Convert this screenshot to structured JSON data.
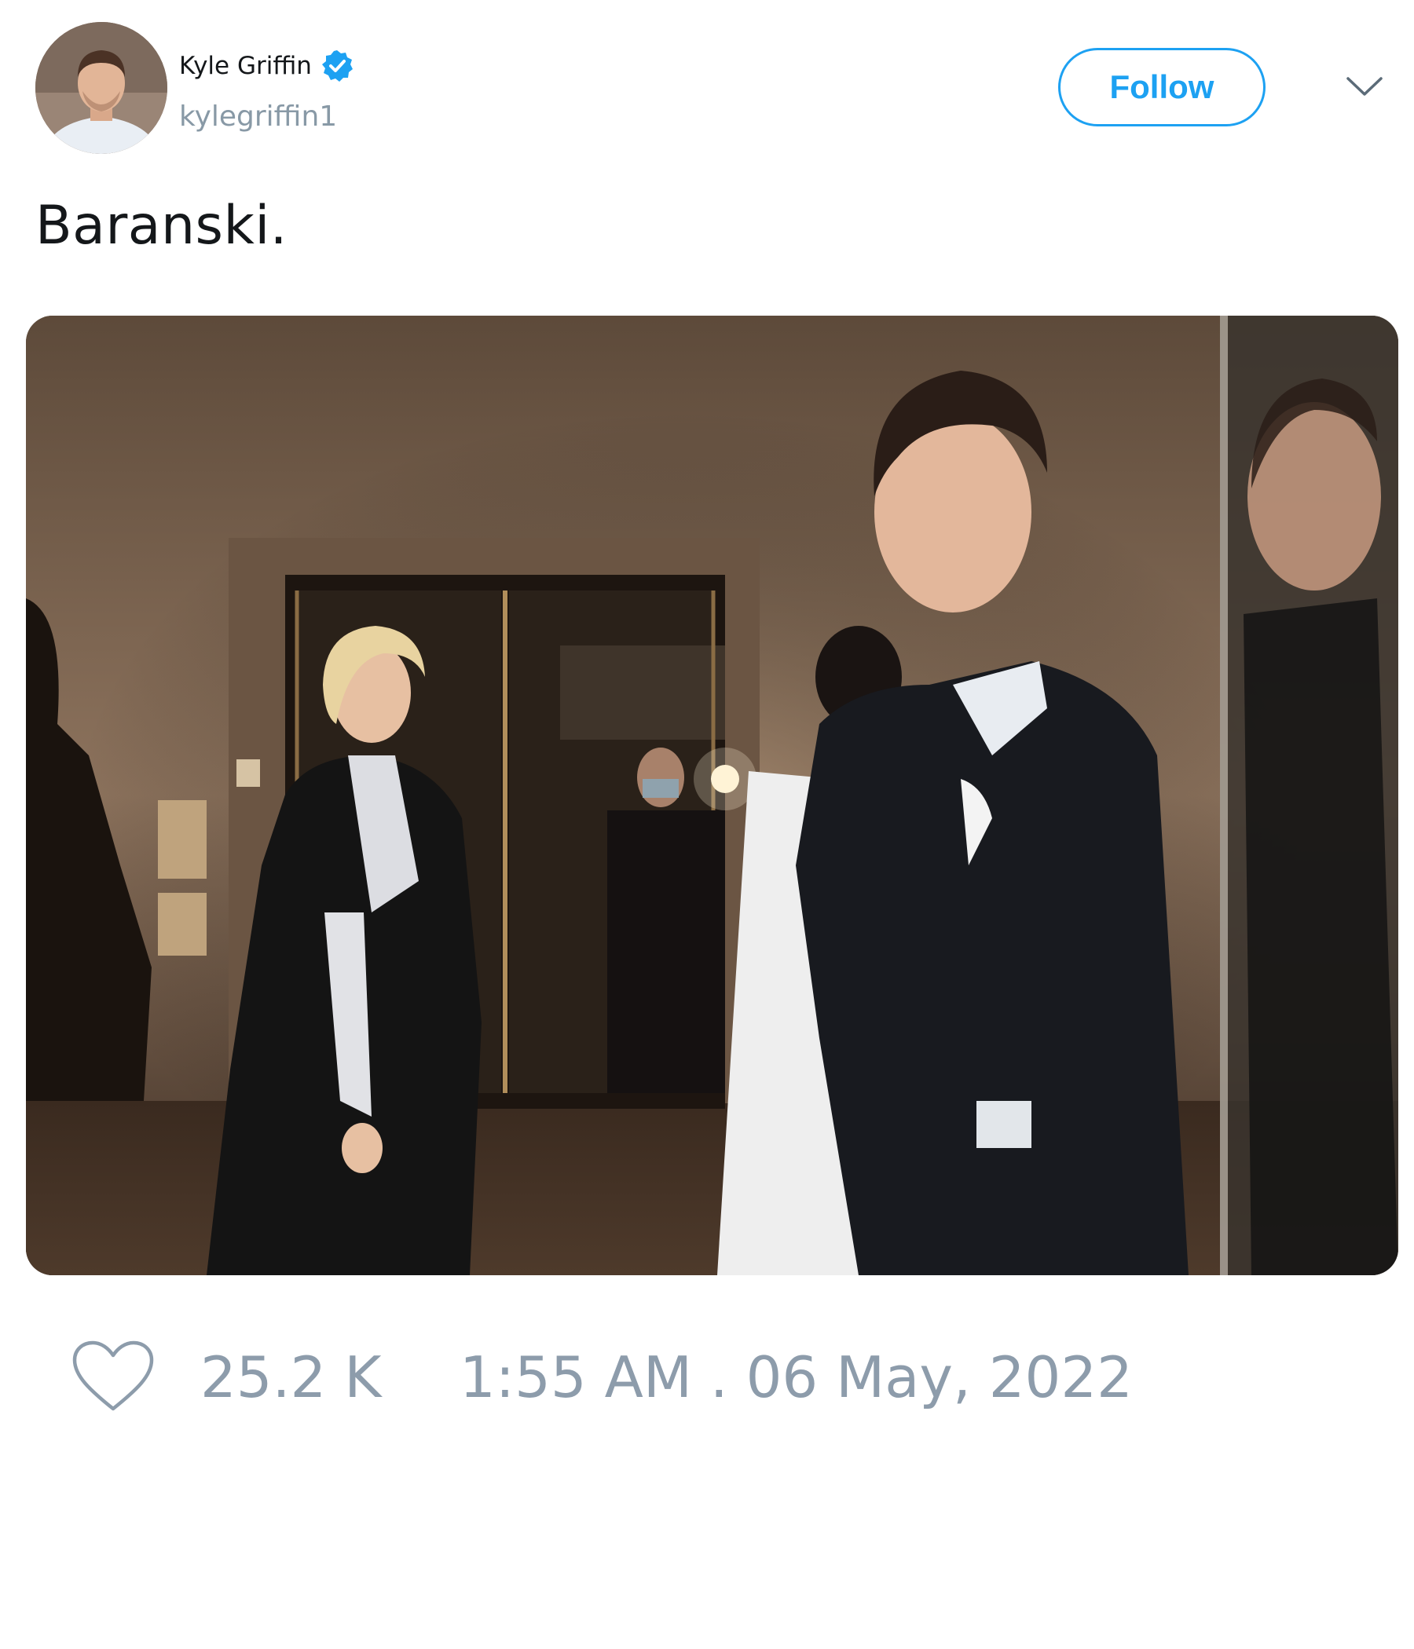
{
  "author": {
    "display_name": "Kyle Griffin",
    "handle": "kylegriffin1",
    "verified": true,
    "avatar_icon": "profile-photo"
  },
  "header": {
    "follow_label": "Follow",
    "menu_icon": "chevron-down-icon"
  },
  "tweet": {
    "text": "Baranski.",
    "media_icon": "photo"
  },
  "footer": {
    "like_icon": "heart-outline-icon",
    "like_count": "25.2 K",
    "timestamp": "1:55 AM . 06 May, 2022"
  },
  "colors": {
    "accent": "#1da1f2",
    "muted_text": "#8899a6",
    "primary_text": "#14171a"
  }
}
